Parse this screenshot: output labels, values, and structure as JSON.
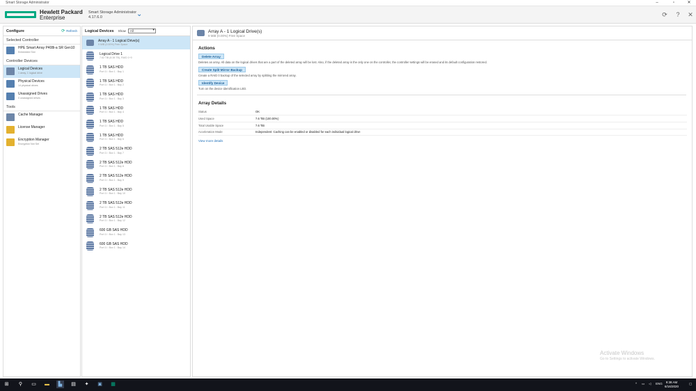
{
  "window": {
    "title": "Smart Storage Administrator",
    "minimize_icon": "minimize-icon",
    "restore_icon": "restore-icon",
    "close_icon": "close-icon"
  },
  "header": {
    "brand_line1": "Hewlett Packard",
    "brand_line2": "Enterprise",
    "app_name": "Smart Storage Administrator",
    "version": "4.17.6.0",
    "accent": "#01a982",
    "refresh_icon": "refresh-icon",
    "help_icon": "help-icon",
    "close_icon": "close-icon"
  },
  "left": {
    "title": "Configure",
    "refresh_label": "Refresh",
    "selected_controller_label": "Selected Controller",
    "controller": {
      "name": "HPE Smart Array P408i-a SR Gen10",
      "sub": "Embedded Slot"
    },
    "devices_label": "Controller Devices",
    "devices": [
      {
        "name": "Logical Devices",
        "sub": "1 array, 1 logical drive"
      },
      {
        "name": "Physical Devices",
        "sub": "14 physical drives"
      },
      {
        "name": "Unassigned Drives",
        "sub": "0 unassigned drives"
      }
    ],
    "tools_label": "Tools",
    "tools": [
      {
        "name": "Cache Manager",
        "sub": ""
      },
      {
        "name": "License Manager",
        "sub": ""
      },
      {
        "name": "Encryption Manager",
        "sub": "Encryption Not Set"
      }
    ]
  },
  "middle": {
    "title": "Logical Devices",
    "show_label": "Show",
    "show_value": "All",
    "items": [
      {
        "name": "Array A - 1 Logical Drive(s)",
        "sub": "9 MiB (0.00%) Free Space",
        "kind": "array"
      },
      {
        "name": "Logical Drive 1",
        "sub": "7.62 TiB (8.38 TB), RAID 1+0",
        "kind": "disk"
      },
      {
        "name": "1 TB SAS HDD",
        "sub": "Port 1I : Box 1 : Bay 1",
        "kind": "disk"
      },
      {
        "name": "1 TB SAS HDD",
        "sub": "Port 1I : Box 1 : Bay 2",
        "kind": "disk"
      },
      {
        "name": "1 TB SAS HDD",
        "sub": "Port 1I : Box 1 : Bay 3",
        "kind": "disk"
      },
      {
        "name": "1 TB SAS HDD",
        "sub": "Port 1I : Box 1 : Bay 4",
        "kind": "disk"
      },
      {
        "name": "1 TB SAS HDD",
        "sub": "Port 1I : Box 1 : Bay 5",
        "kind": "disk"
      },
      {
        "name": "1 TB SAS HDD",
        "sub": "Port 1I : Box 1 : Bay 6",
        "kind": "disk"
      },
      {
        "name": "2 TB SAS 512e HDD",
        "sub": "Port 1I : Box 1 : Bay 7",
        "kind": "disk"
      },
      {
        "name": "2 TB SAS 512e HDD",
        "sub": "Port 1I : Box 1 : Bay 8",
        "kind": "disk"
      },
      {
        "name": "2 TB SAS 512e HDD",
        "sub": "Port 1I : Box 1 : Bay 9",
        "kind": "disk"
      },
      {
        "name": "2 TB SAS 512e HDD",
        "sub": "Port 1I : Box 1 : Bay 10",
        "kind": "disk"
      },
      {
        "name": "2 TB SAS 512e HDD",
        "sub": "Port 1I : Box 1 : Bay 11",
        "kind": "disk"
      },
      {
        "name": "2 TB SAS 512e HDD",
        "sub": "Port 1I : Box 1 : Bay 12",
        "kind": "disk"
      },
      {
        "name": "600 GB SAS HDD",
        "sub": "Port 1I : Box 1 : Bay 13",
        "kind": "disk"
      },
      {
        "name": "600 GB SAS HDD",
        "sub": "Port 1I : Box 1 : Bay 14",
        "kind": "disk"
      }
    ]
  },
  "right": {
    "title": "Array A - 1 Logical Drive(s)",
    "subtitle": "9 MiB (0.00%) Free Space",
    "actions_title": "Actions",
    "actions": [
      {
        "label": "Delete Array",
        "desc": "Deletes an array. All data on the logical drives that are a part of the deleted array will be lost. Also, if the deleted array is the only one on the controller, the controller settings will be erased and its default configuration restored."
      },
      {
        "label": "Create Split Mirror Backup",
        "desc": "Create a RAID 0 backup of the selected array by splitting the mirrored array."
      },
      {
        "label": "Identify Device",
        "desc": "Turn on the device identification LED."
      }
    ],
    "details_title": "Array Details",
    "details": [
      {
        "key": "Status",
        "value": "OK"
      },
      {
        "key": "Used Space",
        "value": "7.6 TiB (100.00%)"
      },
      {
        "key": "Total Usable Space",
        "value": "7.6 TiB"
      },
      {
        "key": "Acceleration Mode",
        "value": "Independent: Caching can be enabled or disabled for each individual logical drive"
      }
    ],
    "view_more": "View more details"
  },
  "watermark": {
    "line1": "Activate Windows",
    "line2": "Go to Settings to activate Windows."
  },
  "taskbar": {
    "start_icon": "windows-start-icon",
    "apps": [
      "search-icon",
      "task-view-icon",
      "file-explorer-icon",
      "ssa-app-icon",
      "terminal-icon",
      "server-manager-icon",
      "network-icon",
      "hpe-app-icon"
    ],
    "language": "ENG",
    "time": "9:38 AM",
    "date": "6/16/2020"
  }
}
